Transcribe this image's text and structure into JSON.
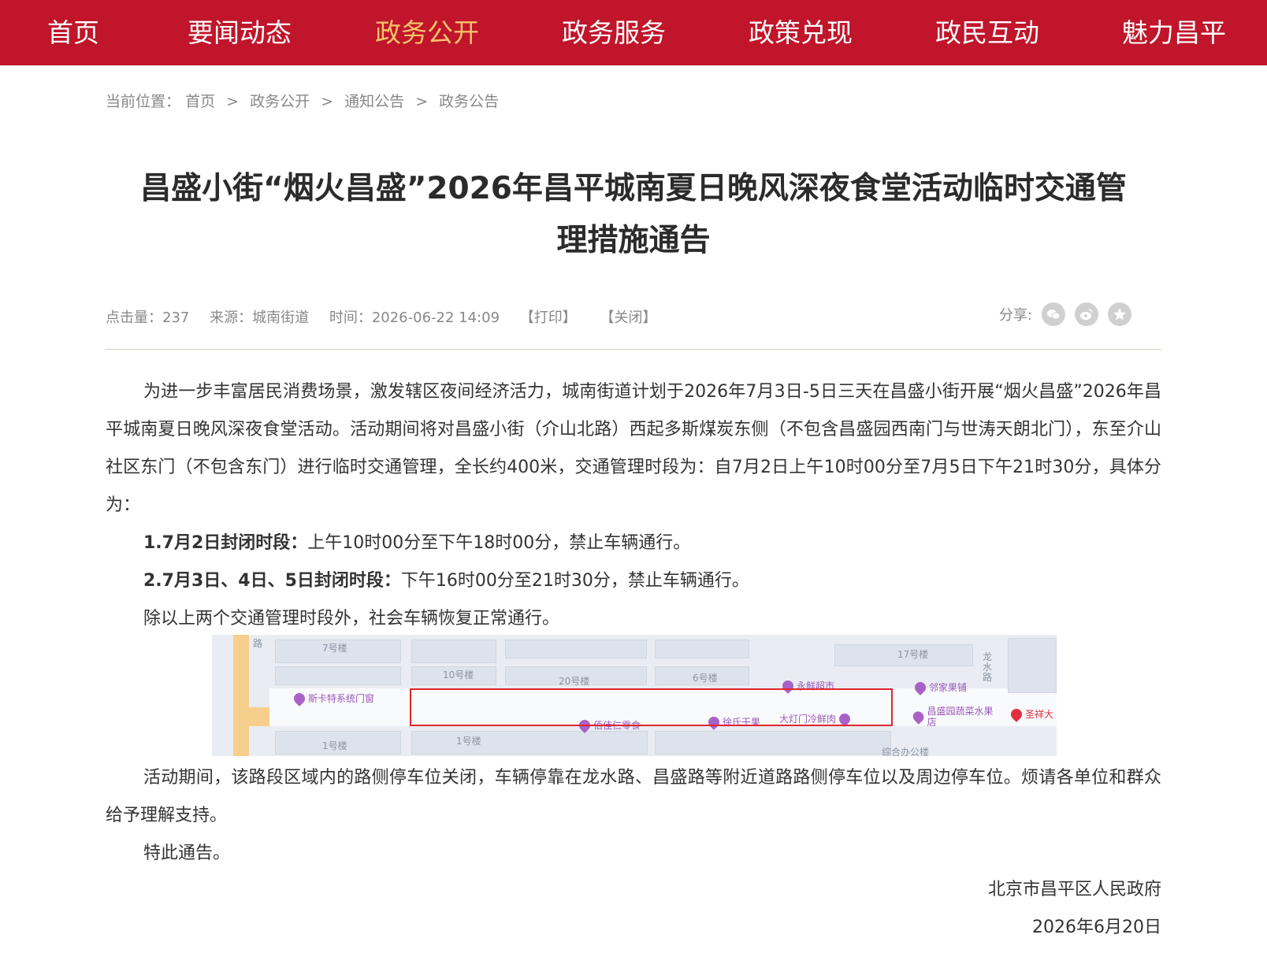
{
  "nav": {
    "items": [
      "首页",
      "要闻动态",
      "政务公开",
      "政务服务",
      "政策兑现",
      "政民互动",
      "魅力昌平"
    ],
    "active_index": 2
  },
  "breadcrumb": {
    "prefix": "当前位置：",
    "items": [
      "首页",
      "政务公开",
      "通知公告",
      "政务公告"
    ],
    "separator": ">"
  },
  "article": {
    "title_line1": "昌盛小街“烟火昌盛”2026年昌平城南夏日晚风深夜食堂活动临时交通管",
    "title_line2": "理措施通告",
    "meta": {
      "views_label": "点击量：",
      "views": "237",
      "source_label": "来源：",
      "source": "城南街道",
      "time_label": "时间：",
      "time": "2026-06-22 14:09",
      "print_label": "【打印】",
      "close_label": "【关闭】",
      "share_label": "分享:"
    },
    "p1": "为进一步丰富居民消费场景，激发辖区夜间经济活力，城南街道计划于2026年7月3日-5日三天在昌盛小街开展“烟火昌盛”2026年昌平城南夏日晚风深夜食堂活动。活动期间将对昌盛小街（介山北路）西起多斯煤炭东侧（不包含昌盛园西南门与世涛天朗北门），东至介山社区东门（不包含东门）进行临时交通管理，全长约400米，交通管理时段为：自7月2日上午10时00分至7月5日下午21时30分，具体分为：",
    "p2_bold": "1.7月2日封闭时段：",
    "p2_text": "上午10时00分至下午18时00分，禁止车辆通行。",
    "p3_bold": "2.7月3日、4日、5日封闭时段：",
    "p3_text": "下午16时00分至21时30分，禁止车辆通行。",
    "p4": "除以上两个交通管理时段外，社会车辆恢复正常通行。",
    "p5": "活动期间，该路段区域内的路侧停车位关闭，车辆停靠在龙水路、昌盛路等附近道路路侧停车位以及周边停车位。烦请各单位和群众给予理解支持。",
    "p6": "特此通告。",
    "signature": "北京市昌平区人民政府",
    "date": "2026年6月20日"
  },
  "map": {
    "labels": [
      "路",
      "7号楼",
      "10号楼",
      "20号楼",
      "6号楼",
      "17号楼",
      "1号楼",
      "1号楼",
      "龙水路"
    ],
    "pois": [
      "斯卡特系统门窗",
      "永鲜超市",
      "邻家果铺",
      "佰佳仁零食",
      "徐氏干果",
      "大灯门冷鲜肉",
      "昌盛园蔬菜水果店",
      "圣祥大"
    ],
    "bottom_label": "综合办公楼"
  }
}
